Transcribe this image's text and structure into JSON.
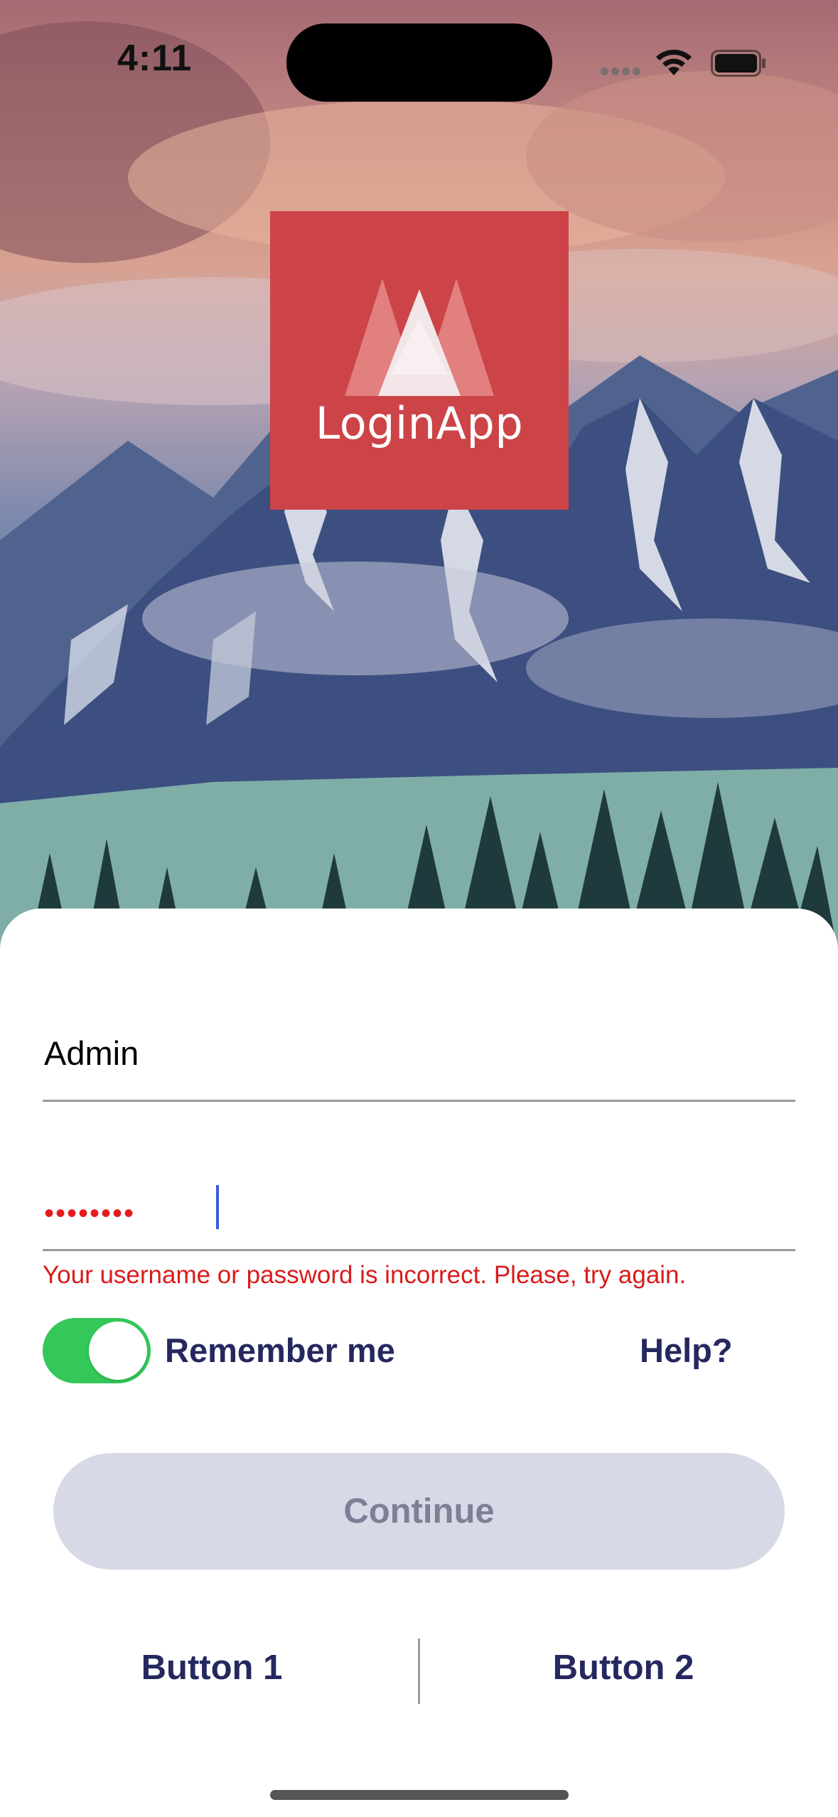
{
  "status_bar": {
    "time": "4:11"
  },
  "logo": {
    "text": "LoginApp",
    "background": "#cc4448"
  },
  "form": {
    "username_value": "Admin",
    "password_masked": "••••••••",
    "error_message": "Your username or password is incorrect. Please, try again.",
    "remember_me_label": "Remember me",
    "remember_me_on": true,
    "help_label": "Help?",
    "continue_label": "Continue"
  },
  "footer": {
    "button1_label": "Button 1",
    "button2_label": "Button 2"
  },
  "colors": {
    "accent_text": "#25285f",
    "error": "#d81c1c",
    "toggle_on": "#34c759",
    "continue_disabled_bg": "#d7d9e7"
  }
}
